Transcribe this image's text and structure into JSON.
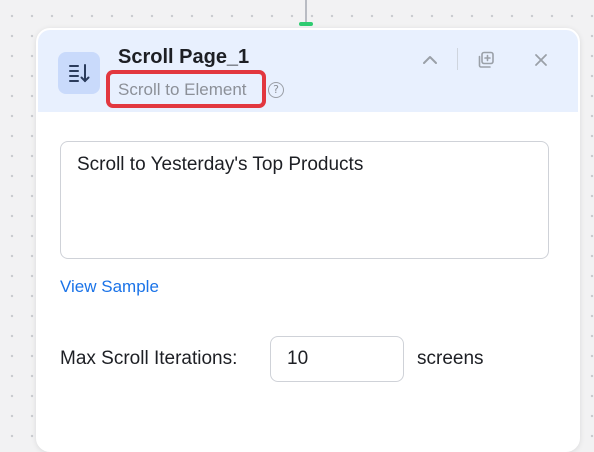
{
  "node": {
    "title": "Scroll Page_1",
    "subtitle": "Scroll to Element",
    "help_symbol": "?",
    "icon": "scroll-list-icon",
    "header_actions": [
      "collapse-icon",
      "duplicate-icon",
      "close-icon"
    ]
  },
  "config": {
    "target_text": "Scroll to Yesterday's Top Products",
    "view_sample_label": "View Sample",
    "max_iterations_label": "Max Scroll Iterations:",
    "max_iterations_value": "10",
    "max_iterations_unit": "screens"
  },
  "colors": {
    "header_bg": "#e8f0fe",
    "accent": "#1a73e8",
    "highlight": "#e2373f",
    "connector": "#2ecc71"
  }
}
